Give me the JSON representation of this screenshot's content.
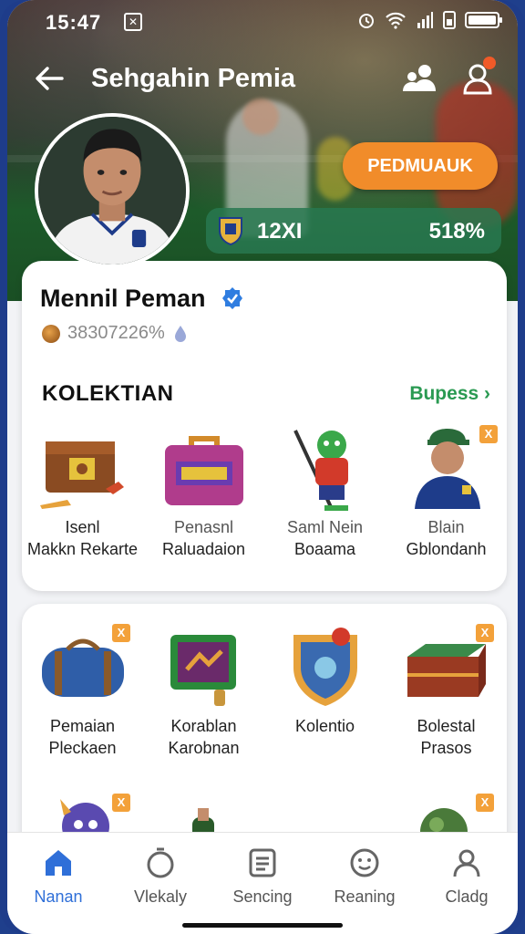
{
  "status_bar": {
    "time": "15:47",
    "notification_glyph": "✕"
  },
  "header": {
    "title": "Sehgahin Pemia"
  },
  "hero": {
    "cta_label": "PEDMUAUK",
    "stat_left": "12XI",
    "stat_right": "518%"
  },
  "profile": {
    "name": "Mennil Peman",
    "sub_value": "38307226%"
  },
  "collection": {
    "title": "KOLEKTIAN",
    "see_all": "Bupess ›",
    "row1": [
      {
        "line1": "Isenl",
        "line2": "Makkn Rekarte"
      },
      {
        "line1": "Penasnl",
        "line2": "Raluadaion"
      },
      {
        "line1": "Saml Nein",
        "line2": "Boaama"
      },
      {
        "line1": "Blain",
        "line2": "Gblondanh",
        "tag": "X"
      }
    ],
    "row2": [
      {
        "line1": "Pemaian",
        "line2": "Pleckaen",
        "tag": "X"
      },
      {
        "line1": "Korablan",
        "line2": "Karobnan"
      },
      {
        "line1": "Kolentio",
        "line2": ""
      },
      {
        "line1": "Bolestal",
        "line2": "Prasos",
        "tag": "X"
      }
    ],
    "row3_tags": [
      "X",
      "X"
    ]
  },
  "nav": [
    {
      "label": "Nanan",
      "icon": "home-icon",
      "active": true
    },
    {
      "label": "Vlekaly",
      "icon": "timer-icon"
    },
    {
      "label": "Sencing",
      "icon": "list-icon"
    },
    {
      "label": "Reaning",
      "icon": "face-icon"
    },
    {
      "label": "Cladg",
      "icon": "profile-icon"
    }
  ],
  "colors": {
    "accent_orange": "#f18c2a",
    "accent_green": "#2a9a52",
    "nav_active": "#2f6fd8",
    "frame_blue": "#1e3c8a"
  }
}
